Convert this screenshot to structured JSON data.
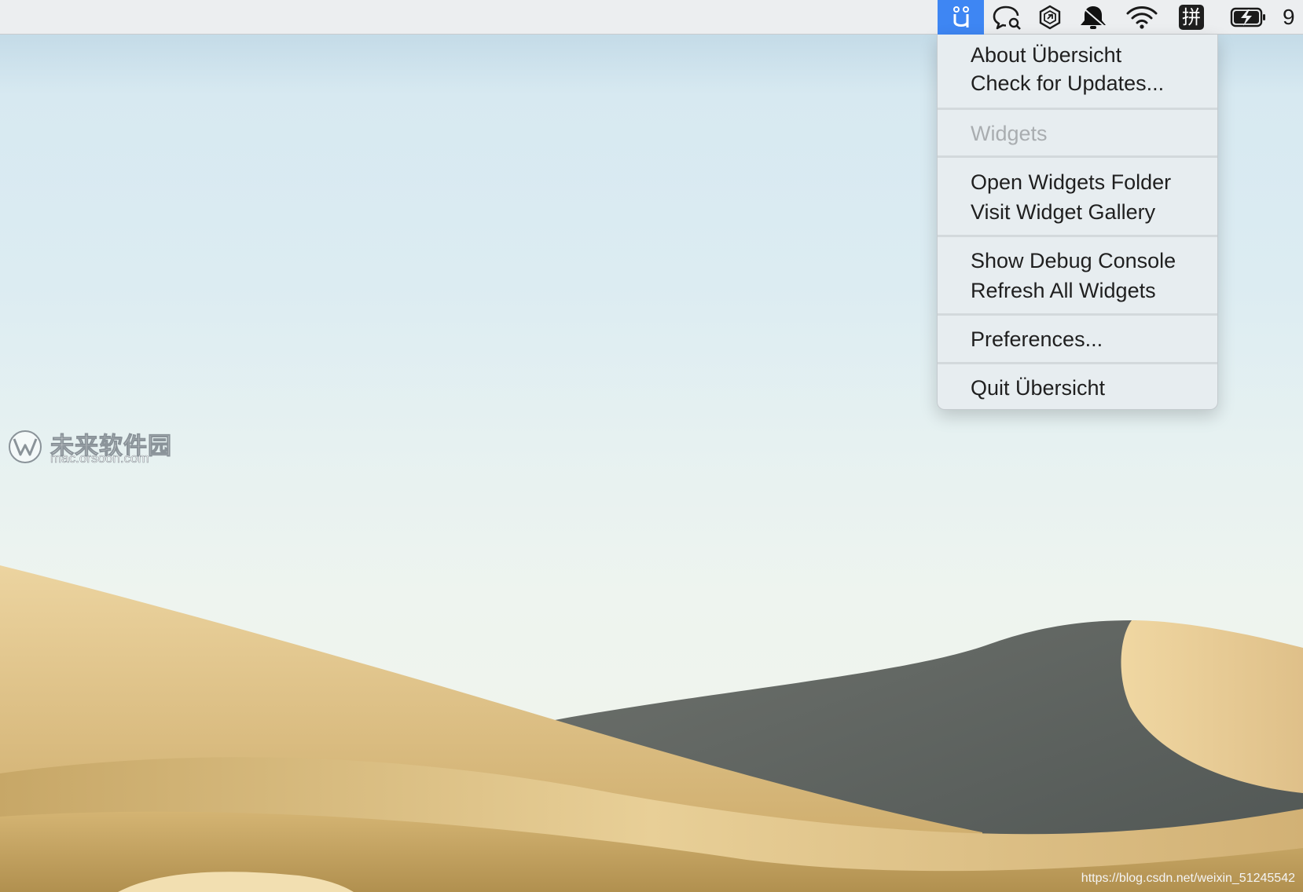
{
  "menubar": {
    "active_app_icon": "ubersicht-icon",
    "icons": [
      "ubersicht-icon",
      "chat-search-icon",
      "hexagon-app-icon",
      "notification-bell-icon",
      "wifi-icon",
      "input-method-icon",
      "battery-charging-icon"
    ],
    "input_method_glyph": "拼",
    "clock_text": "9",
    "active_color": "#3e86f3"
  },
  "menu": {
    "items": [
      {
        "label": "About Übersicht",
        "enabled": true
      },
      {
        "label": "Check for Updates...",
        "enabled": true
      },
      {
        "label": "Widgets",
        "enabled": false
      },
      {
        "label": "Open Widgets Folder",
        "enabled": true
      },
      {
        "label": "Visit Widget Gallery",
        "enabled": true
      },
      {
        "label": "Show Debug Console",
        "enabled": true
      },
      {
        "label": "Refresh All Widgets",
        "enabled": true
      },
      {
        "label": "Preferences...",
        "enabled": true
      },
      {
        "label": "Quit Übersicht",
        "enabled": true
      }
    ]
  },
  "watermark": {
    "brand_cn": "未来软件园",
    "url": "mac.orsoon.com"
  },
  "footer_url": "https://blog.csdn.net/weixin_51245542",
  "colors": {
    "sky_top": "#b9d3e2",
    "sand_light": "#e9cf96",
    "sand_dark": "#c9a965",
    "shadow_dune": "#5f6461"
  }
}
